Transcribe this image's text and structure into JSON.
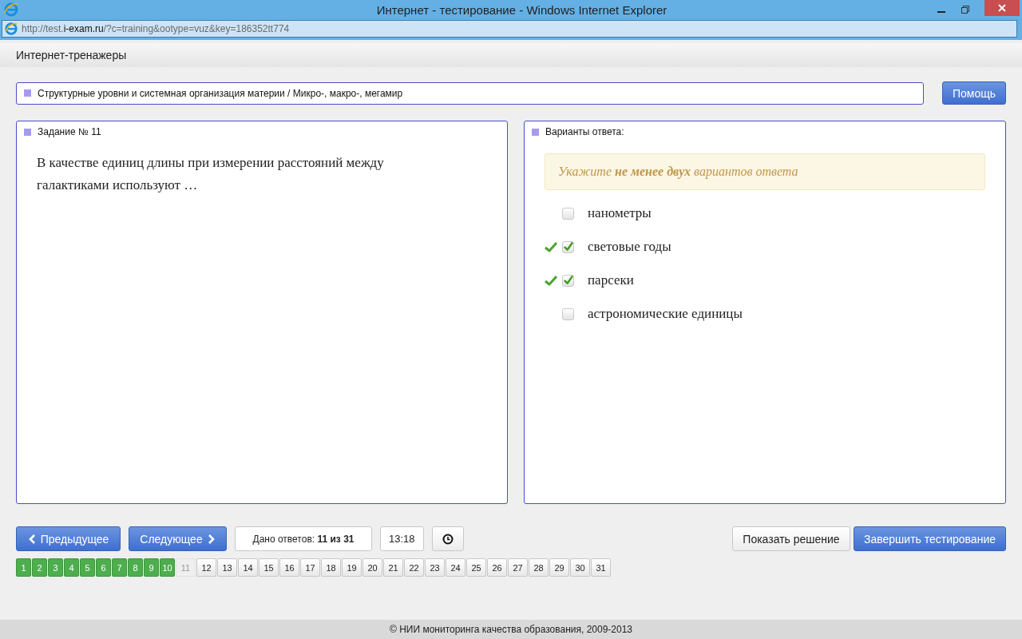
{
  "window": {
    "title": "Интернет - тестирование - Windows Internet Explorer"
  },
  "address": {
    "prefix": "http://test.",
    "host": "i-exam.ru",
    "rest": "/?c=training&ootype=vuz&key=186352tt774"
  },
  "site_bar": {
    "title": "Интернет-тренажеры"
  },
  "breadcrumb": "Структурные уровни и системная организация материи / Микро-, макро-, мегамир",
  "help_button": "Помощь",
  "task": {
    "heading": "Задание № 11",
    "text": "В качестве единиц длины при измерении расстояний между галактиками используют …"
  },
  "answers": {
    "heading": "Варианты ответа:",
    "hint": "Укажите **не менее двух** вариантов ответа",
    "options": [
      {
        "label": "нанометры",
        "checked": false,
        "correct_mark": false
      },
      {
        "label": "световые годы",
        "checked": true,
        "correct_mark": true
      },
      {
        "label": "парсеки",
        "checked": true,
        "correct_mark": true
      },
      {
        "label": "астрономические единицы",
        "checked": false,
        "correct_mark": false
      }
    ]
  },
  "nav": {
    "prev": "Предыдущее",
    "next": "Следующее",
    "answered": "Дано ответов: **11 из 31**",
    "timer": "13:18",
    "show_solution": "Показать решение",
    "finish": "Завершить тестирование"
  },
  "pager": [
    {
      "label": "1",
      "answered": true,
      "selected": false
    },
    {
      "label": "2",
      "answered": true,
      "selected": false
    },
    {
      "label": "3",
      "answered": true,
      "selected": false
    },
    {
      "label": "4",
      "answered": true,
      "selected": false
    },
    {
      "label": "5",
      "answered": true,
      "selected": false
    },
    {
      "label": "6",
      "answered": true,
      "selected": false
    },
    {
      "label": "7",
      "answered": true,
      "selected": false
    },
    {
      "label": "8",
      "answered": true,
      "selected": false
    },
    {
      "label": "9",
      "answered": true,
      "selected": false
    },
    {
      "label": "10",
      "answered": true,
      "selected": false
    },
    {
      "label": "11",
      "answered": false,
      "selected": true
    },
    {
      "label": "12",
      "answered": false,
      "selected": false
    },
    {
      "label": "13",
      "answered": false,
      "selected": false
    },
    {
      "label": "14",
      "answered": false,
      "selected": false
    },
    {
      "label": "15",
      "answered": false,
      "selected": false
    },
    {
      "label": "16",
      "answered": false,
      "selected": false
    },
    {
      "label": "17",
      "answered": false,
      "selected": false
    },
    {
      "label": "18",
      "answered": false,
      "selected": false
    },
    {
      "label": "19",
      "answered": false,
      "selected": false
    },
    {
      "label": "20",
      "answered": false,
      "selected": false
    },
    {
      "label": "21",
      "answered": false,
      "selected": false
    },
    {
      "label": "22",
      "answered": false,
      "selected": false
    },
    {
      "label": "23",
      "answered": false,
      "selected": false
    },
    {
      "label": "24",
      "answered": false,
      "selected": false
    },
    {
      "label": "25",
      "answered": false,
      "selected": false
    },
    {
      "label": "26",
      "answered": false,
      "selected": false
    },
    {
      "label": "27",
      "answered": false,
      "selected": false
    },
    {
      "label": "28",
      "answered": false,
      "selected": false
    },
    {
      "label": "29",
      "answered": false,
      "selected": false
    },
    {
      "label": "30",
      "answered": false,
      "selected": false
    },
    {
      "label": "31",
      "answered": false,
      "selected": false
    }
  ],
  "footer": "© НИИ мониторинга качества образования, 2009-2013"
}
